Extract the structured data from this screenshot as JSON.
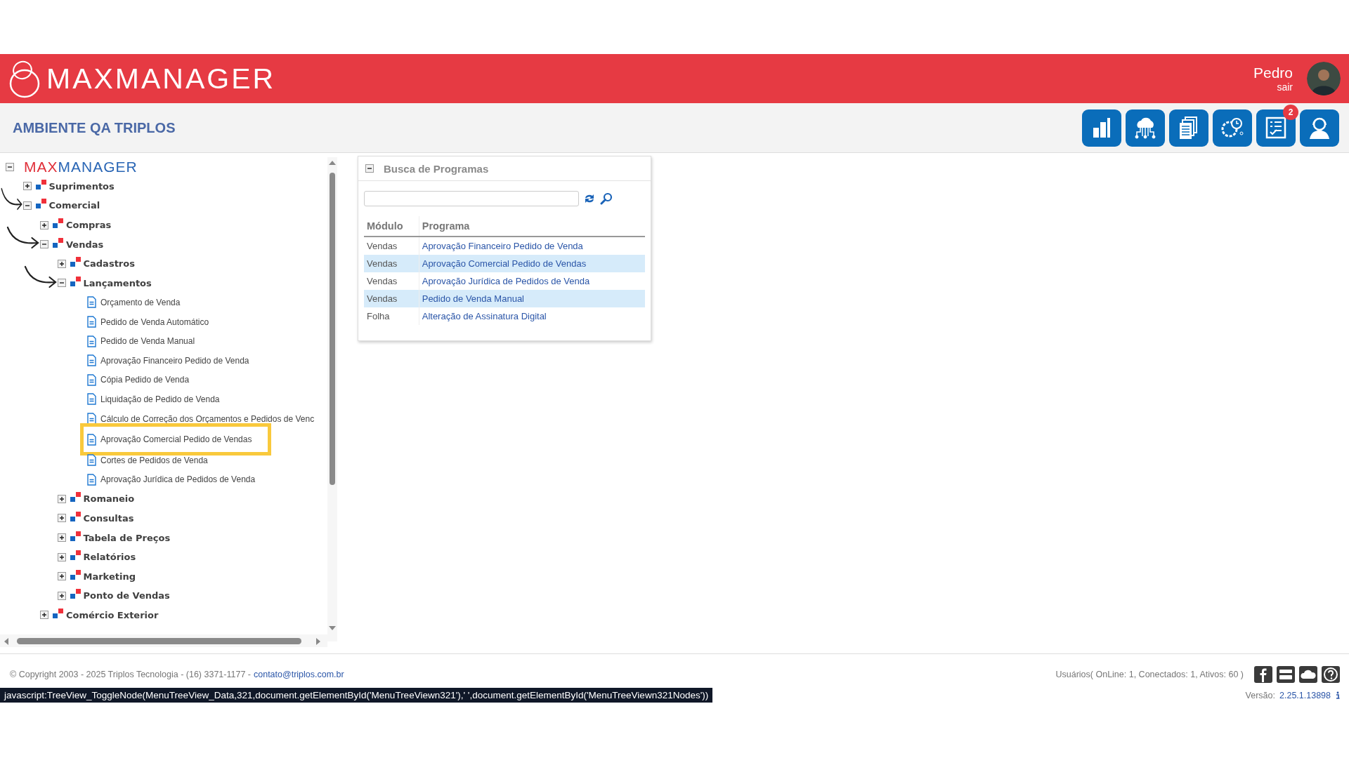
{
  "brand": {
    "name": "MAXMANAGER"
  },
  "user": {
    "name": "Pedro",
    "logout": "sair"
  },
  "environment": "AMBIENTE QA TRIPLOS",
  "notification_badge": "2",
  "tree": {
    "logo_left": "MAX",
    "logo_right": "MANAGER",
    "expanded": true,
    "children": [
      {
        "label": "Suprimentos",
        "kind": "folder",
        "expanded": false,
        "pointer": false,
        "highlighted": false
      },
      {
        "label": "Comercial",
        "kind": "folder",
        "expanded": true,
        "pointer": true,
        "highlighted": false,
        "children": [
          {
            "label": "Compras",
            "kind": "folder",
            "expanded": false,
            "pointer": false,
            "highlighted": false
          },
          {
            "label": "Vendas",
            "kind": "folder",
            "expanded": true,
            "pointer": true,
            "highlighted": false,
            "children": [
              {
                "label": "Cadastros",
                "kind": "folder",
                "expanded": false,
                "pointer": false,
                "highlighted": false
              },
              {
                "label": "Lançamentos",
                "kind": "folder",
                "expanded": true,
                "pointer": true,
                "highlighted": false,
                "children": [
                  {
                    "label": "Orçamento de Venda",
                    "kind": "program",
                    "pointer": false,
                    "highlighted": false
                  },
                  {
                    "label": "Pedido de Venda Automático",
                    "kind": "program",
                    "pointer": false,
                    "highlighted": false
                  },
                  {
                    "label": "Pedido de Venda Manual",
                    "kind": "program",
                    "pointer": false,
                    "highlighted": false
                  },
                  {
                    "label": "Aprovação Financeiro Pedido de Venda",
                    "kind": "program",
                    "pointer": false,
                    "highlighted": false
                  },
                  {
                    "label": "Cópia Pedido de Venda",
                    "kind": "program",
                    "pointer": false,
                    "highlighted": false
                  },
                  {
                    "label": "Liquidação de Pedido de Venda",
                    "kind": "program",
                    "pointer": false,
                    "highlighted": false
                  },
                  {
                    "label": "Cálculo de Correção dos Orçamentos e Pedidos de Venc",
                    "kind": "program",
                    "pointer": false,
                    "highlighted": false
                  },
                  {
                    "label": "Aprovação Comercial Pedido de Vendas",
                    "kind": "program",
                    "pointer": false,
                    "highlighted": true
                  },
                  {
                    "label": "Cortes de Pedidos de Venda",
                    "kind": "program",
                    "pointer": false,
                    "highlighted": false
                  },
                  {
                    "label": "Aprovação Jurídica de Pedidos de Venda",
                    "kind": "program",
                    "pointer": false,
                    "highlighted": false
                  }
                ]
              },
              {
                "label": "Romaneio",
                "kind": "folder",
                "expanded": false,
                "pointer": false,
                "highlighted": false
              },
              {
                "label": "Consultas",
                "kind": "folder",
                "expanded": false,
                "pointer": false,
                "highlighted": false
              },
              {
                "label": "Tabela de Preços",
                "kind": "folder",
                "expanded": false,
                "pointer": false,
                "highlighted": false
              },
              {
                "label": "Relatórios",
                "kind": "folder",
                "expanded": false,
                "pointer": false,
                "highlighted": false
              },
              {
                "label": "Marketing",
                "kind": "folder",
                "expanded": false,
                "pointer": false,
                "highlighted": false
              },
              {
                "label": "Ponto de Vendas",
                "kind": "folder",
                "expanded": false,
                "pointer": false,
                "highlighted": false
              }
            ]
          },
          {
            "label": "Comércio Exterior",
            "kind": "folder",
            "expanded": false,
            "pointer": false,
            "highlighted": false
          }
        ]
      }
    ]
  },
  "search_panel": {
    "title": "Busca de Programas",
    "expanded": true,
    "columns": [
      "Módulo",
      "Programa"
    ],
    "rows": [
      {
        "module": "Vendas",
        "program": "Aprovação Financeiro Pedido de Venda"
      },
      {
        "module": "Vendas",
        "program": "Aprovação Comercial Pedido de Vendas"
      },
      {
        "module": "Vendas",
        "program": "Aprovação Jurídica de Pedidos de Venda"
      },
      {
        "module": "Vendas",
        "program": "Pedido de Venda Manual"
      },
      {
        "module": "Folha",
        "program": "Alteração de Assinatura Digital"
      }
    ]
  },
  "footer": {
    "copyright": "© Copyright 2003 - 2025 Triplos Tecnologia - (16) 3371-1177 -",
    "email": "contato@triplos.com.br",
    "users": "Usuários( OnLine: 1, Conectados: 1, Ativos: 60 )",
    "version_label": "Versão:",
    "version": "2.25.1.13898"
  },
  "status_text": "javascript:TreeView_ToggleNode(MenuTreeView_Data,321,document.getElementById('MenuTreeViewn321'),' ',document.getElementById('MenuTreeViewn321Nodes'))"
}
